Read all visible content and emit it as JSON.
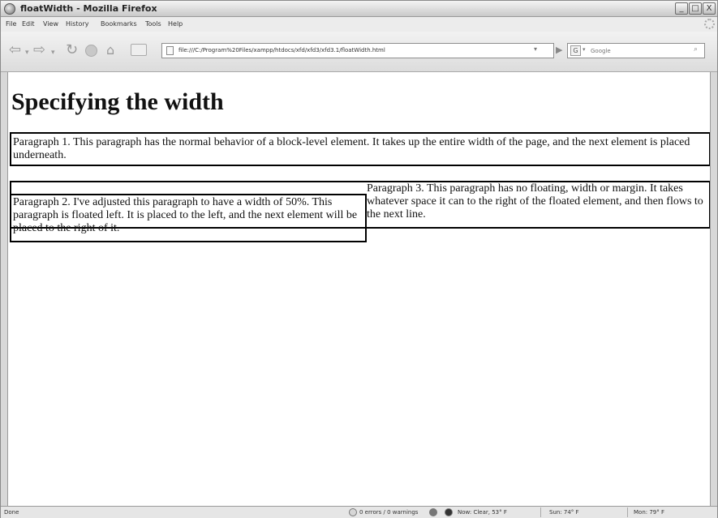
{
  "window": {
    "title": "floatWidth - Mozilla Firefox",
    "min_label": "_",
    "max_label": "□",
    "close_label": "X"
  },
  "menu": {
    "items": [
      "File",
      "Edit",
      "View",
      "History",
      "Bookmarks",
      "Tools",
      "Help"
    ]
  },
  "toolbar": {
    "back_glyph": "⇦",
    "forward_glyph": "⇨",
    "dropdown_glyph": "▾",
    "reload_glyph": "↻",
    "home_glyph": "⌂",
    "go_glyph": "▶",
    "url": "file:///C:/Program%20Files/xampp/htdocs/xfd/xfd3/xfd3.1/floatWidth.html",
    "search_engine_glyph": "G",
    "search_placeholder": "Google",
    "search_go_glyph": "⌕"
  },
  "page": {
    "heading": "Specifying the width",
    "paragraph_1": "Paragraph 1. This paragraph has the normal behavior of a block-level element. It takes up the entire width of the page, and the next element is placed underneath.",
    "paragraph_2": "Paragraph 2. I've adjusted this paragraph to have a width of 50%. This paragraph is floated left. It is placed to the left, and the next element will be placed to the right of it.",
    "paragraph_3": "Paragraph 3. This paragraph has no floating, width or margin. It takes whatever space it can to the right of the floated element, and then flows to the next line."
  },
  "status": {
    "text": "Done",
    "errors": "0 errors / 0 warnings",
    "weather_now": "Now: Clear, 53° F",
    "weather_sun": "Sun: 74° F",
    "weather_mon": "Mon: 79° F"
  },
  "colors": {
    "chrome": "#d8d8d8",
    "content_background": "#ffffff",
    "paragraph_border": "#000000"
  },
  "icons": [
    "app-icon",
    "back-icon",
    "forward-icon",
    "reload-icon",
    "stop-icon",
    "home-icon",
    "new-tab-icon",
    "page-icon",
    "go-icon",
    "google-icon",
    "search-icon",
    "throbber-icon",
    "status-check-icon",
    "weather-icon"
  ]
}
